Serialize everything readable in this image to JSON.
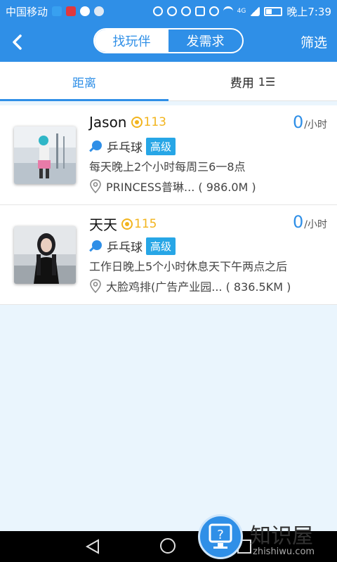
{
  "status_bar": {
    "carrier": "中国移动",
    "network": "4G",
    "time": "晚上7:39"
  },
  "header": {
    "tabs": [
      "找玩伴",
      "发需求"
    ],
    "active_tab": "找玩伴",
    "filter_label": "筛选"
  },
  "sort_bar": {
    "distance_label": "距离",
    "fee_label": "费用",
    "active": "距离"
  },
  "players": [
    {
      "name": "Jason",
      "level": "113",
      "price": "0",
      "price_unit": "/小时",
      "sport": "乒乓球",
      "skill": "高级",
      "schedule": "每天晚上2个小时每周三6一8点",
      "location": "PRINCESS普琳... ( 986.0M )"
    },
    {
      "name": "天天",
      "level": "115",
      "price": "0",
      "price_unit": "/小时",
      "sport": "乒乓球",
      "skill": "高级",
      "schedule": "工作日晚上5个小时休息天下午两点之后",
      "location": "大脸鸡排(广告产业园... ( 836.5KM )"
    }
  ],
  "watermark": {
    "text": "知识屋",
    "url": "zhishiwu.com"
  },
  "colors": {
    "primary": "#2f8fe7",
    "level": "#f2b41d",
    "badge": "#27a6e6",
    "background": "#eaf5fd"
  }
}
